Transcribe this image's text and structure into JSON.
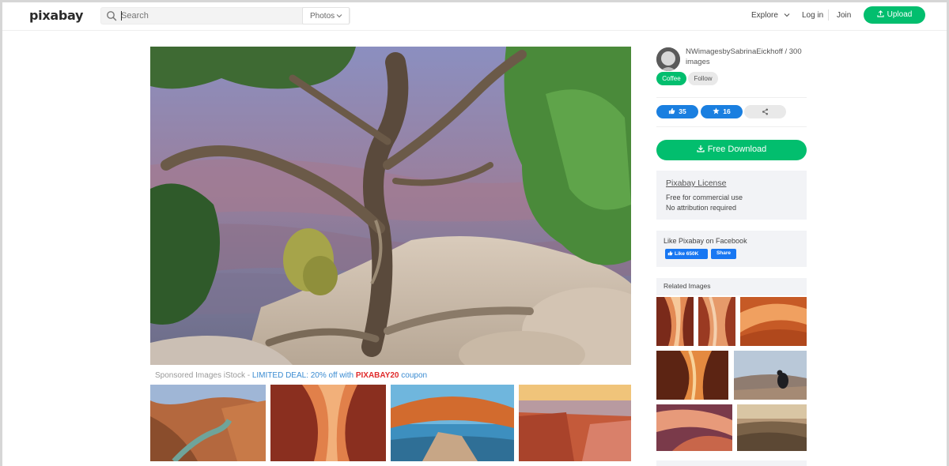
{
  "header": {
    "logo": "pixabay",
    "search_placeholder": "Search",
    "search_type": "Photos",
    "nav": {
      "explore": "Explore",
      "login": "Log in",
      "join": "Join"
    },
    "upload_label": "Upload"
  },
  "sponsored": {
    "prefix": "Sponsored Images iStock - ",
    "deal": "LIMITED DEAL: 20% off with ",
    "code": "PIXABAY20",
    "suffix": " coupon"
  },
  "sidebar": {
    "author": "NWimagesbySabrinaEickhoff / 300 images",
    "coffee_label": "Coffee",
    "follow_label": "Follow",
    "likes": "35",
    "favorites": "16",
    "download_label": "Free Download",
    "license": {
      "title": "Pixabay License",
      "line1": "Free for commercial use",
      "line2": "No attribution required"
    },
    "facebook": {
      "title": "Like Pixabay on Facebook",
      "like_label": "Like 650K",
      "share_label": "Share"
    },
    "related_title": "Related Images"
  },
  "colors": {
    "accent_green": "#02be6e",
    "like_blue": "#1a7fe0",
    "facebook_blue": "#1877f2",
    "deal_blue": "#3a8bd1",
    "coupon_red": "#e02b2b"
  }
}
